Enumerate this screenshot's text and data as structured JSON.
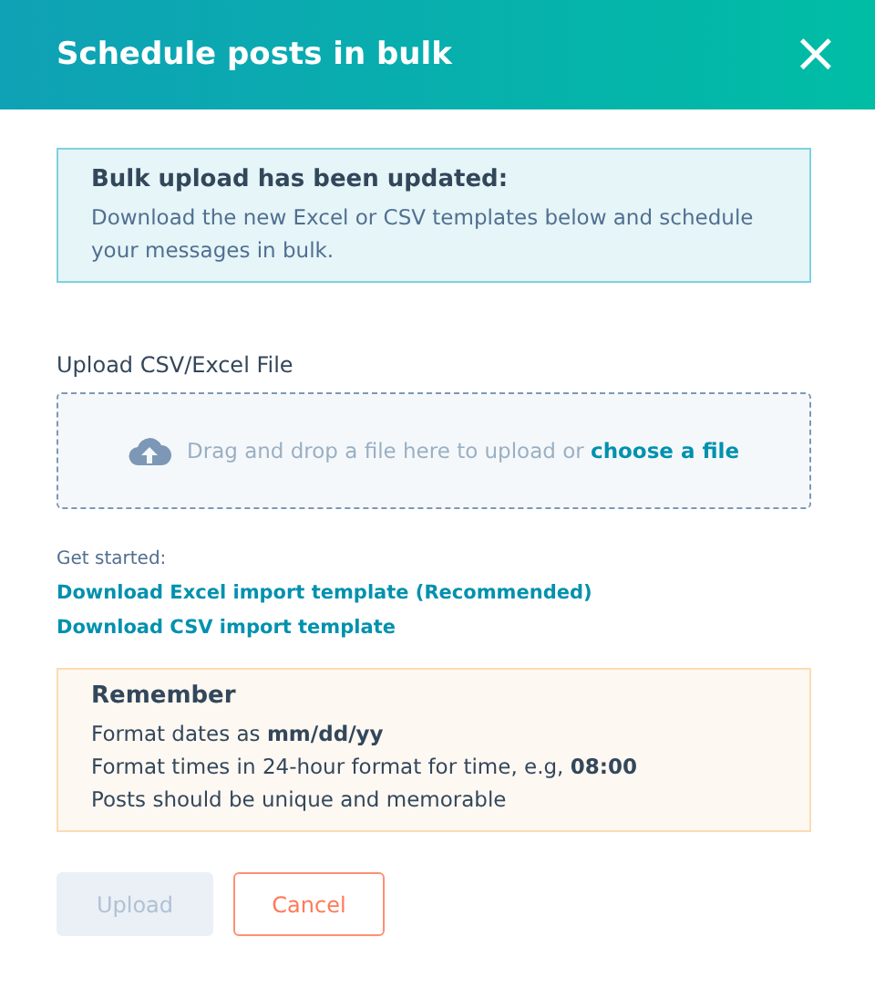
{
  "dialog": {
    "title": "Schedule posts in bulk",
    "close": "×"
  },
  "notice": {
    "title": "Bulk upload has been updated:",
    "text": "Download the new Excel or CSV templates below and schedule your messages in bulk."
  },
  "upload": {
    "label": "Upload CSV/Excel File",
    "drop_text": "Drag and drop a file here to upload or",
    "link": "choose a file"
  },
  "get_started": {
    "label": "Get started:",
    "links": [
      "Download Excel import template (Recommended)",
      "Download CSV import template"
    ]
  },
  "remember": {
    "title": "Remember",
    "lines": [
      "Format dates as **mm/dd/yy**",
      "Format times in 24-hour format for time, e.g, **08:00**",
      "Posts should be unique and memorable"
    ]
  },
  "buttons": [
    {
      "label": "Upload",
      "kind": "primary",
      "disabled": true
    },
    {
      "label": "Cancel",
      "kind": "secondary",
      "disabled": false
    }
  ]
}
